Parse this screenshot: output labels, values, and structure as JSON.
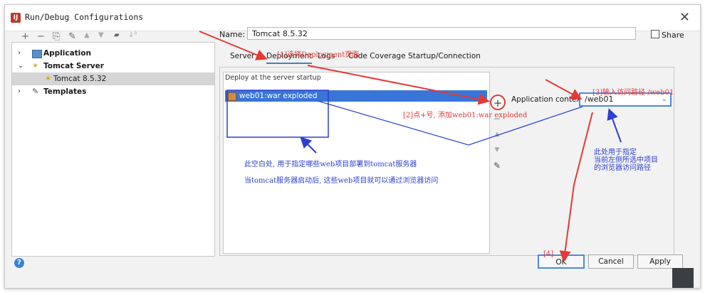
{
  "window": {
    "title": "Run/Debug Configurations",
    "close_glyph": "✕",
    "app_icon": "intellij-icon"
  },
  "toolbar": {
    "items": [
      "+",
      "−",
      "⎘",
      "✎",
      "▲",
      "▼",
      "▰",
      "↓⁰"
    ]
  },
  "tree": {
    "items": [
      {
        "label": "Application",
        "expand": "›",
        "icon": "application-icon"
      },
      {
        "label": "Tomcat Server",
        "expand": "⌄",
        "icon": "tomcat-icon"
      },
      {
        "label": "Tomcat 8.5.32",
        "expand": "",
        "icon": "tomcat-icon",
        "selected": true
      },
      {
        "label": "Templates",
        "expand": "›",
        "icon": "wrench-icon"
      }
    ]
  },
  "config": {
    "name_label": "Name:",
    "name_value": "Tomcat 8.5.32",
    "share_label": "Share",
    "tabs": [
      "Server",
      "Deployment",
      "Logs",
      "Code Coverage",
      "Startup/Connection"
    ],
    "active_tab": "Deployment"
  },
  "deployment": {
    "section_title": "Deploy at the server startup",
    "items": [
      {
        "label": "web01:war exploded",
        "icon": "artifact-icon"
      }
    ],
    "side_buttons": {
      "add": "+",
      "remove": "−",
      "up": "▲",
      "down": "▼",
      "edit": "✎"
    },
    "context_label": "Application context:",
    "context_value": "/web01"
  },
  "buttons": {
    "ok": "OK",
    "cancel": "Cancel",
    "apply": "Apply",
    "help": "?"
  },
  "annotations": {
    "step1": "[1]选择Deployment页面",
    "step2": "[2]点+号, 添加web01:war exploded",
    "step3": "[3]输入访问路径 /web01",
    "step4": "[4]",
    "deploy_note_line1": "此空白处, 用于指定哪些web项目部署到tomcat服务器",
    "deploy_note_line2": "当tomcat服务器启动后, 这些web项目就可以通过浏览器访问",
    "context_note_line1": "此处用于指定",
    "context_note_line2": "当前左侧所选中项目",
    "context_note_line3": "的浏览器访问路径"
  },
  "colors": {
    "annotation_red": "#e53935",
    "annotation_blue": "#2b3fd1",
    "selection": "#3875d7",
    "focus": "#4a8be0"
  }
}
